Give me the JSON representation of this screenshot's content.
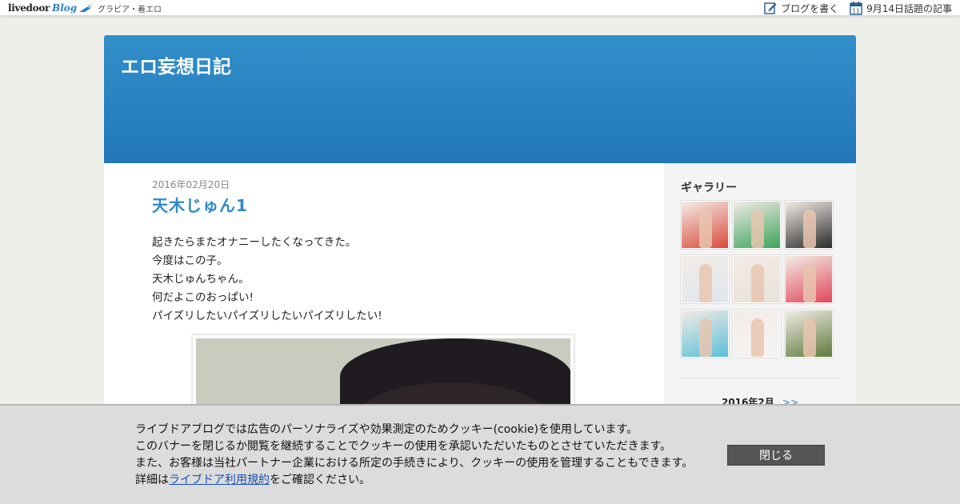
{
  "topbar": {
    "logo_main": "livedoor",
    "logo_blog": "Blog",
    "category": "グラビア・着エロ",
    "write_label": "ブログを書く",
    "calendar_day": "11",
    "topic_label": "9月14日話題の記事"
  },
  "blog": {
    "title": "エロ妄想日記"
  },
  "post": {
    "date": "2016年02月20日",
    "title": "天木じゅん1",
    "lines": [
      "起きたらまたオナニーしたくなってきた。",
      "今度はこの子。",
      "天木じゅんちゃん。",
      "何だよこのおっぱい!",
      "パイズリしたいパイズリしたいパイズリしたい!"
    ]
  },
  "sidebar": {
    "gallery_title": "ギャラリー",
    "thumbnails": [
      {
        "accent": "#d94a3a"
      },
      {
        "accent": "#3aa35c"
      },
      {
        "accent": "#2a2a2a"
      },
      {
        "accent": "#dfe6ee"
      },
      {
        "accent": "#e8e2d9"
      },
      {
        "accent": "#e0485a"
      },
      {
        "accent": "#5bbfd8"
      },
      {
        "accent": "#f4f4f4"
      },
      {
        "accent": "#5d7a3c"
      }
    ],
    "calendar_month": "2016年2月",
    "calendar_next": ">>"
  },
  "cookie": {
    "line1": "ライブドアブログでは広告のパーソナライズや効果測定のためクッキー(cookie)を使用しています。",
    "line2": "このバナーを閉じるか閲覧を継続することでクッキーの使用を承認いただいたものとさせていただきます。",
    "line3": "また、お客様は当社パートナー企業における所定の手続きにより、クッキーの使用を管理することもできます。",
    "line4_prefix": "詳細は",
    "line4_link": "ライブドア利用規約",
    "line4_suffix": "をご確認ください。",
    "close_label": "閉じる"
  },
  "colors": {
    "header_blue": "#2a84c2",
    "title_blue": "#2e8ac8",
    "background": "#efefea"
  }
}
